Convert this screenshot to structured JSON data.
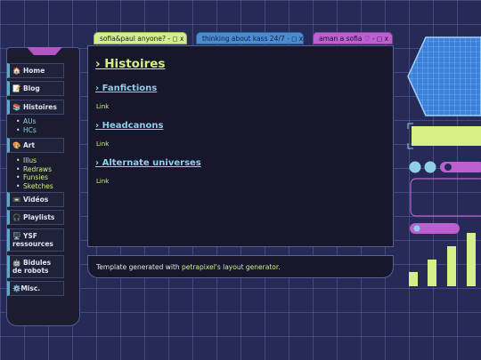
{
  "sidebar": {
    "items": [
      {
        "icon": "house-icon",
        "label": "🏠 Home"
      },
      {
        "icon": "memo-icon",
        "label": "📝 Blog"
      },
      {
        "icon": "books-icon",
        "label": "📚 Histoires"
      },
      {
        "icon": "palette-icon",
        "label": "🎨 Art"
      },
      {
        "icon": "film-icon",
        "label": "📼 Vidéos"
      },
      {
        "icon": "headphones-icon",
        "label": "🎧 Playlists"
      },
      {
        "icon": "computer-icon",
        "label": "🖥️ YSF ressources"
      },
      {
        "icon": "robot-icon",
        "label": "🤖 Bidules de robots"
      },
      {
        "icon": "gear-icon",
        "label": "⚙️Misc."
      }
    ],
    "histoires_sub": [
      "AUs",
      "HCs"
    ],
    "art_sub": [
      "Illus",
      "Redraws",
      "Funsies",
      "Sketches"
    ]
  },
  "tabs": [
    {
      "label": "sofia&paul anyone? - ◻ x"
    },
    {
      "label": "thinking about kass 24/7 - ◻ x"
    },
    {
      "label": "aman a sofia ♡ - ◻ x"
    }
  ],
  "main": {
    "title": "› Histoires",
    "sections": [
      {
        "heading": "› Fanfictions",
        "link": "Link"
      },
      {
        "heading": "› Headcanons",
        "link": "Link"
      },
      {
        "heading": "› Alternate universes",
        "link": "Link"
      }
    ]
  },
  "footer": {
    "prefix": "Template generated with ",
    "link": "petrapixel's layout generator",
    "suffix": "."
  },
  "colors": {
    "background": "#262a56",
    "accent_green": "#d6ef86",
    "accent_blue": "#8fd0e8",
    "accent_purple": "#bc5fd1",
    "panel": "#16172a"
  }
}
